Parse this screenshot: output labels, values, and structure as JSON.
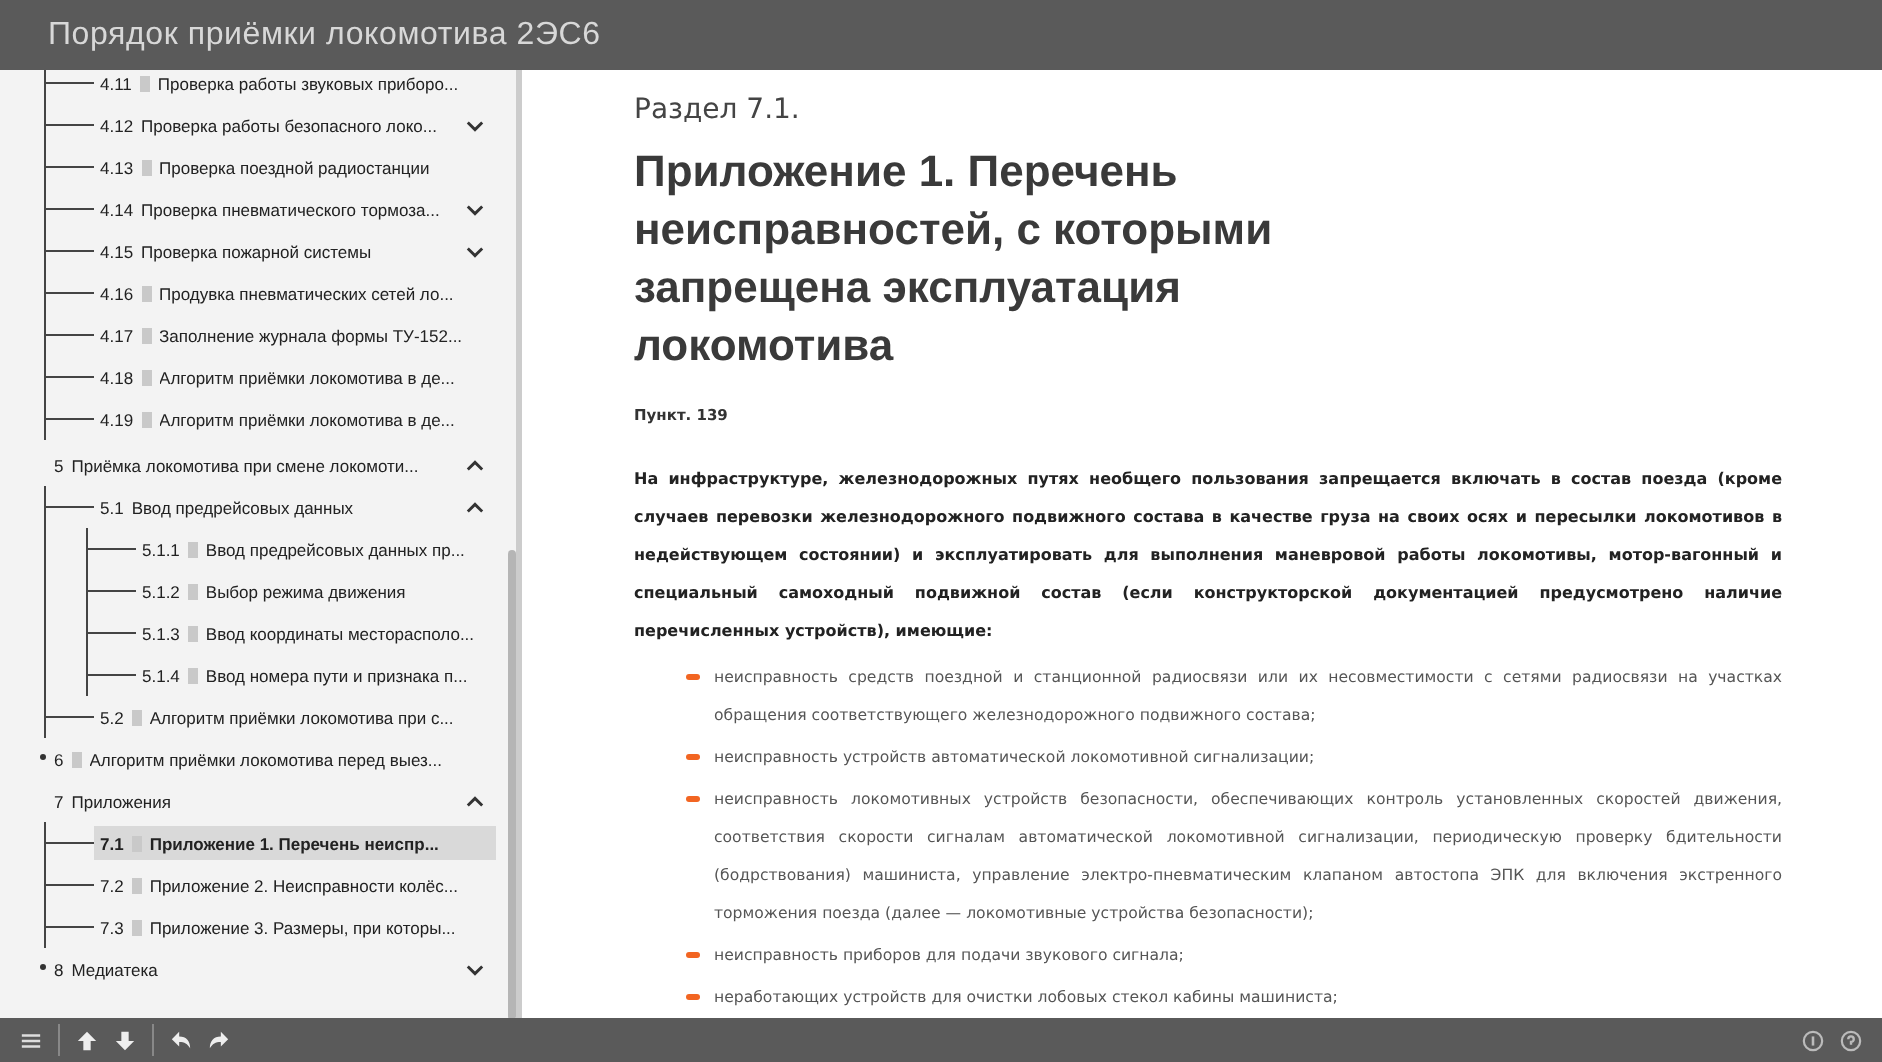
{
  "window": {
    "title": "Порядок приёмки локомотива 2ЭС6"
  },
  "sidebar": {
    "tree": [
      {
        "kind": "partial",
        "children": [
          {
            "kind": "page",
            "number": "4.11",
            "label": "Проверка работы звуковых приборо...",
            "selected": false
          },
          {
            "kind": "group",
            "number": "4.12",
            "label": "Проверка работы безопасного локо...",
            "expanded": false,
            "selected": false
          },
          {
            "kind": "page",
            "number": "4.13",
            "label": "Проверка поездной радиостанции",
            "selected": false
          },
          {
            "kind": "group",
            "number": "4.14",
            "label": "Проверка пневматического тормоза...",
            "expanded": false,
            "selected": false
          },
          {
            "kind": "group",
            "number": "4.15",
            "label": "Проверка пожарной системы",
            "expanded": false,
            "selected": false
          },
          {
            "kind": "page",
            "number": "4.16",
            "label": "Продувка пневматических сетей ло...",
            "selected": false
          },
          {
            "kind": "page",
            "number": "4.17",
            "label": "Заполнение журнала формы ТУ-152...",
            "selected": false
          },
          {
            "kind": "page",
            "number": "4.18",
            "label": "Алгоритм приёмки локомотива в де...",
            "selected": false
          },
          {
            "kind": "page",
            "number": "4.19",
            "label": "Алгоритм приёмки локомотива в де...",
            "selected": false
          }
        ]
      },
      {
        "kind": "group",
        "number": "5",
        "label": "Приёмка локомотива при смене локомоти...",
        "expanded": true,
        "selected": false,
        "children": [
          {
            "kind": "group",
            "number": "5.1",
            "label": "Ввод предрейсовых данных",
            "expanded": true,
            "selected": false,
            "children": [
              {
                "kind": "page",
                "number": "5.1.1",
                "label": "Ввод предрейсовых данных пр...",
                "selected": false
              },
              {
                "kind": "page",
                "number": "5.1.2",
                "label": "Выбор режима движения",
                "selected": false
              },
              {
                "kind": "page",
                "number": "5.1.3",
                "label": "Ввод координаты месторасполо...",
                "selected": false
              },
              {
                "kind": "page",
                "number": "5.1.4",
                "label": "Ввод номера пути и признака п...",
                "selected": false
              }
            ]
          },
          {
            "kind": "page",
            "number": "5.2",
            "label": "Алгоритм приёмки локомотива при с...",
            "selected": false
          }
        ]
      },
      {
        "kind": "page",
        "number": "6",
        "label": "Алгоритм приёмки локомотива перед выез...",
        "selected": false
      },
      {
        "kind": "group",
        "number": "7",
        "label": "Приложения",
        "expanded": true,
        "selected": false,
        "children": [
          {
            "kind": "page",
            "number": "7.1",
            "label": "Приложение 1. Перечень неиспр...",
            "selected": true
          },
          {
            "kind": "page",
            "number": "7.2",
            "label": "Приложение 2. Неисправности колёс...",
            "selected": false
          },
          {
            "kind": "page",
            "number": "7.3",
            "label": "Приложение 3. Размеры, при которы...",
            "selected": false
          }
        ]
      },
      {
        "kind": "group",
        "number": "8",
        "label": "Медиатека",
        "expanded": false,
        "selected": false
      }
    ]
  },
  "content": {
    "section": "Раздел 7.1.",
    "heading": "Приложение 1. Перечень неисправностей, с которыми запрещена эксплуатация локомотива",
    "clause": "Пункт. 139",
    "intro": "На инфраструктуре, железнодорожных путях необщего пользования запрещается включать в состав поезда (кроме случаев перевозки железнодорожного подвижного состава в качестве груза на своих осях и пересылки локомотивов в недействующем состоянии) и эксплуатировать для выполнения маневровой работы локомотивы, мотор-вагонный и специальный самоходный подвижной состав (если конструкторской документацией предусмотрено наличие перечисленных устройств), имеющие:",
    "bullets": [
      "неисправность средств поездной и станционной радиосвязи или их несовместимости с сетями радиосвязи на участках обращения соответствующего железнодорожного подвижного состава;",
      "неисправность устройств автоматической локомотивной сигнализации;",
      "неисправность локомотивных устройств безопасности, обеспечивающих контроль установленных скоростей движения, соответствия скорости сигналам автоматической локомотивной сигнализации, периодическую проверку бдительности (бодрствования) машиниста, управление электро-пневматическим клапаном автостопа ЭПК для включения экстренного торможения поезда (далее — локомотивные устройства безопасности);",
      "неисправность приборов для подачи звукового сигнала;",
      "неработающих устройств для очистки лобовых стекол кабины машиниста;"
    ]
  }
}
